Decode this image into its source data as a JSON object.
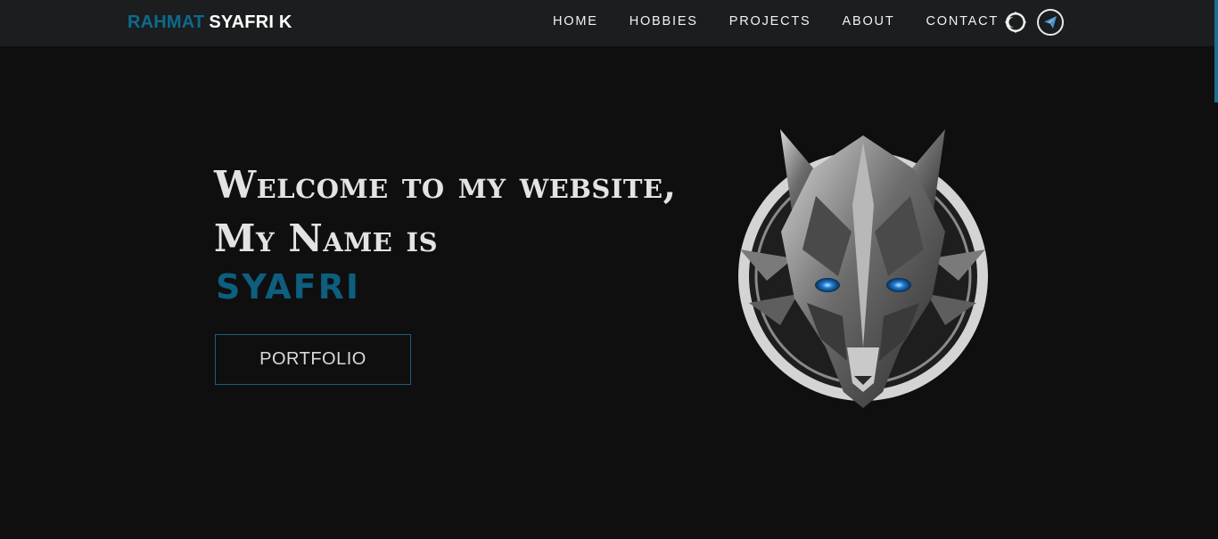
{
  "brand": {
    "first": "RAHMAT",
    "rest": "SYAFRI K"
  },
  "nav": {
    "items": [
      {
        "label": "HOME"
      },
      {
        "label": "HOBBIES"
      },
      {
        "label": "PROJECTS"
      },
      {
        "label": "ABOUT"
      },
      {
        "label": "CONTACT"
      }
    ],
    "theme_toggle_icon": "moon-icon",
    "send_icon": "paper-plane-icon"
  },
  "hero": {
    "line1": "Welcome to my website,",
    "line2": "My Name is",
    "name": "SYAFRI",
    "button_label": "PORTFOLIO",
    "image_icon": "wolf-emblem"
  },
  "colors": {
    "accent": "#0e6a8c",
    "background": "#0f0f10",
    "navbar": "#1b1d1e"
  }
}
